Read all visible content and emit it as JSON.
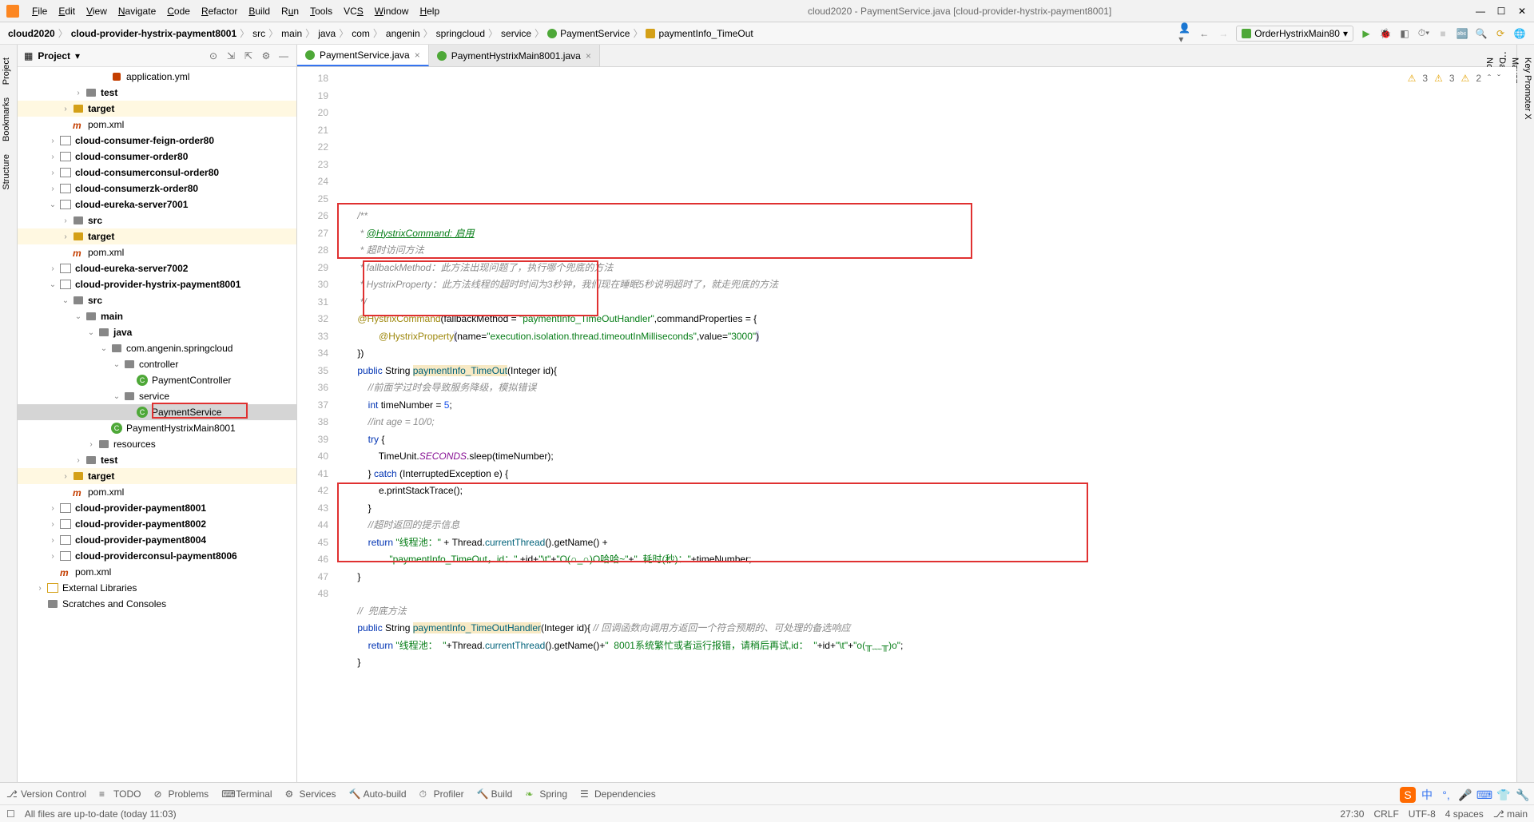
{
  "window": {
    "title": "cloud2020 - PaymentService.java [cloud-provider-hystrix-payment8001]"
  },
  "menu": [
    "File",
    "Edit",
    "View",
    "Navigate",
    "Code",
    "Refactor",
    "Build",
    "Run",
    "Tools",
    "VCS",
    "Window",
    "Help"
  ],
  "breadcrumb": [
    "cloud2020",
    "cloud-provider-hystrix-payment8001",
    "src",
    "main",
    "java",
    "com",
    "angenin",
    "springcloud",
    "service",
    "PaymentService",
    "paymentInfo_TimeOut"
  ],
  "runConfig": "OrderHystrixMain80",
  "projectPanel": {
    "title": "Project"
  },
  "tree": [
    {
      "indent": 5,
      "arrow": "",
      "icon": "yml",
      "name": "application.yml",
      "normal": true
    },
    {
      "indent": 3,
      "arrow": "›",
      "icon": "folder",
      "name": "test"
    },
    {
      "indent": 2,
      "arrow": "›",
      "icon": "folder-o",
      "name": "target",
      "target": true
    },
    {
      "indent": 2,
      "arrow": "",
      "icon": "xml",
      "name": "pom.xml",
      "normal": true
    },
    {
      "indent": 1,
      "arrow": "›",
      "icon": "mod",
      "name": "cloud-consumer-feign-order80"
    },
    {
      "indent": 1,
      "arrow": "›",
      "icon": "mod",
      "name": "cloud-consumer-order80"
    },
    {
      "indent": 1,
      "arrow": "›",
      "icon": "mod",
      "name": "cloud-consumerconsul-order80"
    },
    {
      "indent": 1,
      "arrow": "›",
      "icon": "mod",
      "name": "cloud-consumerzk-order80"
    },
    {
      "indent": 1,
      "arrow": "v",
      "icon": "mod",
      "name": "cloud-eureka-server7001"
    },
    {
      "indent": 2,
      "arrow": "›",
      "icon": "folder",
      "name": "src"
    },
    {
      "indent": 2,
      "arrow": "›",
      "icon": "folder-o",
      "name": "target",
      "target": true
    },
    {
      "indent": 2,
      "arrow": "",
      "icon": "xml",
      "name": "pom.xml",
      "normal": true
    },
    {
      "indent": 1,
      "arrow": "›",
      "icon": "mod",
      "name": "cloud-eureka-server7002"
    },
    {
      "indent": 1,
      "arrow": "v",
      "icon": "mod",
      "name": "cloud-provider-hystrix-payment8001"
    },
    {
      "indent": 2,
      "arrow": "v",
      "icon": "folder",
      "name": "src"
    },
    {
      "indent": 3,
      "arrow": "v",
      "icon": "folder",
      "name": "main"
    },
    {
      "indent": 4,
      "arrow": "v",
      "icon": "folder",
      "name": "java"
    },
    {
      "indent": 5,
      "arrow": "v",
      "icon": "folder",
      "name": "com.angenin.springcloud",
      "normal": true
    },
    {
      "indent": 6,
      "arrow": "v",
      "icon": "folder",
      "name": "controller",
      "normal": true
    },
    {
      "indent": 7,
      "arrow": "",
      "icon": "java",
      "name": "PaymentController",
      "normal": true
    },
    {
      "indent": 6,
      "arrow": "v",
      "icon": "folder",
      "name": "service",
      "normal": true
    },
    {
      "indent": 7,
      "arrow": "",
      "icon": "java",
      "name": "PaymentService",
      "normal": true,
      "selected": true
    },
    {
      "indent": 5,
      "arrow": "",
      "icon": "java",
      "name": "PaymentHystrixMain8001",
      "normal": true
    },
    {
      "indent": 4,
      "arrow": "›",
      "icon": "folder",
      "name": "resources",
      "normal": true
    },
    {
      "indent": 3,
      "arrow": "›",
      "icon": "folder",
      "name": "test"
    },
    {
      "indent": 2,
      "arrow": "›",
      "icon": "folder-o",
      "name": "target",
      "target": true
    },
    {
      "indent": 2,
      "arrow": "",
      "icon": "xml",
      "name": "pom.xml",
      "normal": true
    },
    {
      "indent": 1,
      "arrow": "›",
      "icon": "mod",
      "name": "cloud-provider-payment8001"
    },
    {
      "indent": 1,
      "arrow": "›",
      "icon": "mod",
      "name": "cloud-provider-payment8002"
    },
    {
      "indent": 1,
      "arrow": "›",
      "icon": "mod",
      "name": "cloud-provider-payment8004"
    },
    {
      "indent": 1,
      "arrow": "›",
      "icon": "mod",
      "name": "cloud-providerconsul-payment8006"
    },
    {
      "indent": 1,
      "arrow": "",
      "icon": "xml",
      "name": "pom.xml",
      "normal": true
    },
    {
      "indent": 0,
      "arrow": "›",
      "icon": "lib",
      "name": "External Libraries",
      "normal": true
    },
    {
      "indent": 0,
      "arrow": "",
      "icon": "folder",
      "name": "Scratches and Consoles",
      "normal": true
    }
  ],
  "tabs": [
    {
      "name": "PaymentService.java",
      "active": true
    },
    {
      "name": "PaymentHystrixMain8001.java",
      "active": false
    }
  ],
  "inspections": {
    "warn1": "3",
    "warn2": "3",
    "weak": "2"
  },
  "lineStart": 18,
  "lineEnd": 48,
  "code": [
    "",
    "    <span class='doc'>/**</span>",
    "    <span class='doc'> * <span class='doctag'>@HystrixCommand: 启用</span></span>",
    "    <span class='doc'> * 超时访问方法</span>",
    "    <span class='doc'> * fallbackMethod：此方法出现问题了，执行哪个兜底的方法</span>",
    "    <span class='doc'> * HystrixProperty：此方法线程的超时时间为3秒钟，我们现在睡眠5秒说明超时了，就走兜底的方法</span>",
    "    <span class='doc'> */</span>",
    "    <span class='ann'>@HystrixCommand</span>(fallbackMethod = <span class='str'>\"paymentInfo_TimeOutHandler\"</span>,commandProperties = {",
    "            <span class='ann'>@HystrixProperty</span><span class='bg-hl'>(</span>name=<span class='str'>\"execution.isolation.thread.timeoutInMilliseconds\"</span>,value=<span class='str'>\"3000\"</span><span class='bg-hl'>)</span>",
    "    })",
    "    <span class='kw'>public</span> String <span class='meth bg-warn'>paymentInfo_TimeOut</span>(Integer id){",
    "        <span class='cmt'>//前面学过时会导致服务降级，模拟错误</span>",
    "        <span class='kw'>int</span> timeNumber = <span class='num'>5</span>;",
    "        <span class='cmt'>//int age = 10/0;</span>",
    "        <span class='kw'>try</span> {",
    "            TimeUnit.<span class='fld'>SECONDS</span>.sleep(timeNumber);",
    "        } <span class='kw'>catch</span> (InterruptedException e) {",
    "            e.printStackTrace();",
    "        }",
    "        <span class='cmt'>//超时返回的提示信息</span>",
    "        <span class='kw'>return</span> <span class='str'>\"线程池：\"</span> + Thread.<span class='meth'>currentThread</span>().getName() +",
    "                <span class='str'>\"paymentInfo_TimeOut，id：\"</span> +id+<span class='str'>\"\\t\"</span>+<span class='str'>\"O(∩_∩)O哈哈~\"</span>+<span class='str'>\"  耗时(秒)：\"</span>+timeNumber;",
    "    }",
    "",
    "    <span class='cmt'>//  兜底方法</span>",
    "    <span class='kw'>public</span> String <span class='meth bg-warn'>paymentInfo_TimeOutHandler</span>(Integer id){ <span class='cmt'>// 回调函数向调用方返回一个符合预期的、可处理的备选响应</span>",
    "        <span class='kw'>return</span> <span class='str'>\"线程池：  \"</span>+Thread.<span class='meth'>currentThread</span>().getName()+<span class='str'>\"  8001系统繁忙或者运行报错，请稍后再试,id：  \"</span>+id+<span class='str'>\"\\t\"</span>+<span class='str'>\"o(╥﹏╥)o\"</span>;",
    "    }",
    "",
    ""
  ],
  "bottomTools": [
    "Version Control",
    "TODO",
    "Problems",
    "Terminal",
    "Services",
    "Auto-build",
    "Profiler",
    "Build",
    "Spring",
    "Dependencies"
  ],
  "status": {
    "msg": "All files are up-to-date (today 11:03)",
    "pos": "27:30",
    "eol": "CRLF",
    "enc": "UTF-8",
    "indent": "4 spaces",
    "branch": "main"
  },
  "leftStrip": [
    "Project",
    "Bookmarks",
    "Structure"
  ],
  "rightStrip": [
    "Key Promoter X",
    "Maven",
    "Database",
    "Notifications"
  ]
}
